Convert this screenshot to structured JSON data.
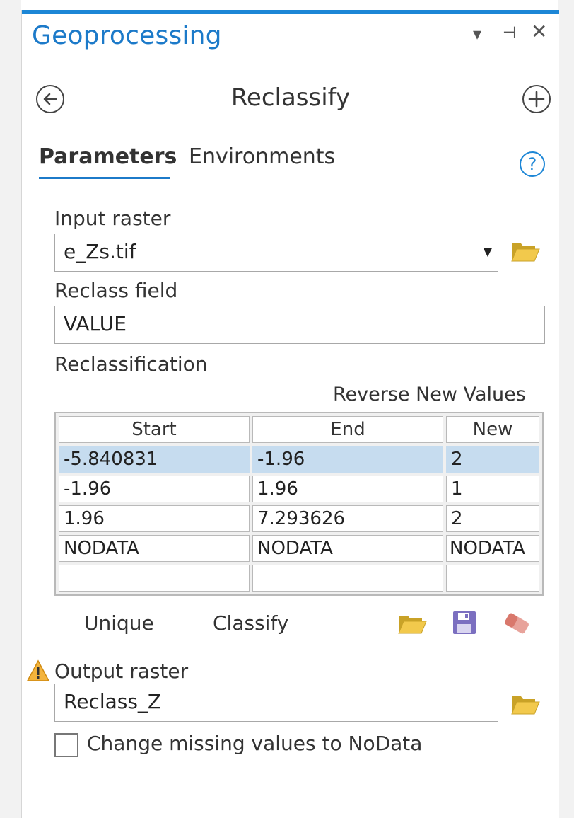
{
  "pane": {
    "title": "Geoprocessing",
    "controls": {
      "dropdown_icon": "chevron-down-icon",
      "pin_icon": "pin-icon",
      "close_icon": "close-icon"
    },
    "accent_color": "#1c86d6"
  },
  "tool": {
    "title": "Reclassify",
    "back_icon": "back-arrow-icon",
    "add_icon": "add-circle-icon"
  },
  "tabs": {
    "parameters": "Parameters",
    "environments": "Environments",
    "help_icon": "help-icon"
  },
  "form": {
    "input_raster": {
      "label": "Input raster",
      "value": "e_Zs.tif"
    },
    "reclass_field": {
      "label": "Reclass field",
      "value": "VALUE"
    },
    "reclassification": {
      "label": "Reclassification",
      "reverse_label": "Reverse New Values",
      "columns": [
        "Start",
        "End",
        "New"
      ],
      "rows": [
        [
          "-5.840831",
          "-1.96",
          "2"
        ],
        [
          "-1.96",
          "1.96",
          "1"
        ],
        [
          "1.96",
          "7.293626",
          "2"
        ],
        [
          "NODATA",
          "NODATA",
          "NODATA"
        ],
        [
          "",
          "",
          ""
        ]
      ],
      "selected_row_color": "#c6dcef"
    },
    "actions": {
      "unique": "Unique",
      "classify": "Classify"
    },
    "output_raster": {
      "label": "Output raster",
      "value": "Reclass_Z",
      "warning_icon": "warning-icon"
    },
    "missing_to_nodata": {
      "label": "Change missing values to NoData",
      "checked": false
    }
  }
}
